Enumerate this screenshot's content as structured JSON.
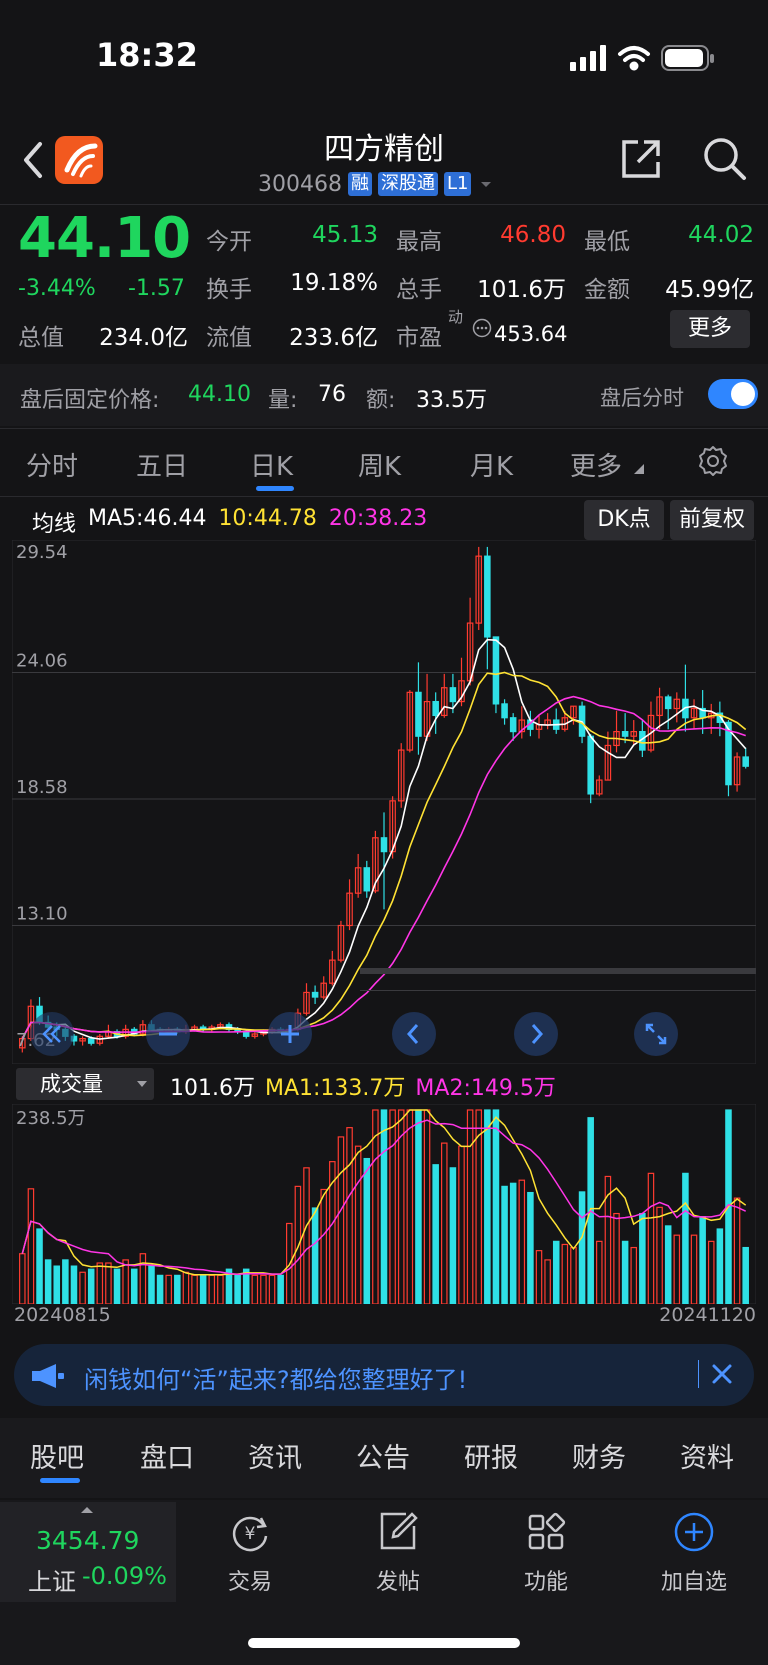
{
  "status": {
    "time": "18:32"
  },
  "header": {
    "title": "四方精创",
    "code": "300468",
    "tags": [
      "融",
      "深股通",
      "L1"
    ]
  },
  "quote": {
    "price": "44.10",
    "change_pct": "-3.44%",
    "change_amt": "-1.57",
    "open_label": "今开",
    "open": "45.13",
    "high_label": "最高",
    "high": "46.80",
    "low_label": "最低",
    "low": "44.02",
    "turnover_label": "换手",
    "turnover": "19.18%",
    "volume_label": "总手",
    "volume": "101.6万",
    "amount_label": "金额",
    "amount": "45.99亿",
    "mktcap_label": "总值",
    "mktcap": "234.0亿",
    "float_label": "流值",
    "float": "233.6亿",
    "pe_label": "市盈",
    "pe_sup": "动",
    "pe": "453.64",
    "more_label": "更多"
  },
  "after_hours": {
    "label": "盘后固定价格:",
    "price": "44.10",
    "vol_label": "量:",
    "vol": "76",
    "amt_label": "额:",
    "amt": "33.5万",
    "toggle_label": "盘后分时",
    "toggle_on": true
  },
  "period_tabs": [
    "分时",
    "五日",
    "日K",
    "周K",
    "月K",
    "更多"
  ],
  "active_period": "日K",
  "ma": {
    "label": "均线",
    "ma5": "MA5:46.44",
    "ma10": "10:44.78",
    "ma20": "20:38.23",
    "dk_btn": "DK点",
    "adj_btn": "前复权"
  },
  "volume_panel": {
    "selector": "成交量",
    "vol": "101.6万",
    "ma1": "MA1:133.7万",
    "ma2": "MA2:149.5万",
    "max_label": "238.5万"
  },
  "dates": {
    "start": "20240815",
    "end": "20241120"
  },
  "banner": {
    "text": "闲钱如何“活”起来?都给您整理好了!"
  },
  "section_tabs": [
    "股吧",
    "盘口",
    "资讯",
    "公告",
    "研报",
    "财务",
    "资料"
  ],
  "active_section": "股吧",
  "bottom_bar": {
    "index_value": "3454.79",
    "index_name": "上证",
    "index_change": "-0.09%",
    "items": [
      "交易",
      "发帖",
      "功能",
      "加自选"
    ]
  },
  "colors": {
    "up": "#ff3b30",
    "down": "#1fd65e",
    "candle_down": "#2fe0e6",
    "ma5": "#ffffff",
    "ma10": "#ffe234",
    "ma20": "#ff35e6",
    "accent": "#2f86ff"
  },
  "chart_data": {
    "type": "candlestick",
    "y_ticks": [
      "29.54",
      "24.06",
      "18.58",
      "13.10",
      "7.62"
    ],
    "ylim": [
      7.62,
      29.54
    ],
    "candles": [
      [
        7.8,
        8.2,
        7.6,
        8.3
      ],
      [
        8.2,
        9.6,
        8.1,
        9.9
      ],
      [
        9.6,
        8.9,
        8.8,
        10.0
      ],
      [
        8.9,
        8.7,
        8.5,
        9.2
      ],
      [
        8.7,
        8.6,
        8.3,
        8.9
      ],
      [
        8.6,
        8.3,
        8.1,
        8.7
      ],
      [
        8.3,
        8.1,
        7.9,
        8.4
      ],
      [
        8.1,
        8.2,
        7.9,
        8.3
      ],
      [
        8.2,
        8.0,
        7.9,
        8.3
      ],
      [
        8.0,
        8.3,
        7.9,
        8.4
      ],
      [
        8.3,
        8.5,
        8.2,
        8.8
      ],
      [
        8.5,
        8.3,
        8.2,
        8.6
      ],
      [
        8.3,
        8.6,
        8.2,
        8.8
      ],
      [
        8.6,
        8.4,
        8.3,
        8.7
      ],
      [
        8.4,
        8.8,
        8.3,
        9.0
      ],
      [
        8.8,
        8.6,
        8.5,
        9.0
      ],
      [
        8.6,
        8.5,
        8.4,
        8.7
      ],
      [
        8.5,
        8.6,
        8.4,
        8.7
      ],
      [
        8.6,
        8.5,
        8.4,
        8.7
      ],
      [
        8.5,
        8.6,
        8.4,
        8.8
      ],
      [
        8.6,
        8.7,
        8.5,
        8.8
      ],
      [
        8.7,
        8.6,
        8.5,
        8.8
      ],
      [
        8.6,
        8.7,
        8.5,
        8.8
      ],
      [
        8.7,
        8.8,
        8.6,
        8.9
      ],
      [
        8.8,
        8.6,
        8.5,
        8.9
      ],
      [
        8.6,
        8.5,
        8.4,
        8.7
      ],
      [
        8.5,
        8.3,
        8.2,
        8.6
      ],
      [
        8.3,
        8.4,
        8.2,
        8.5
      ],
      [
        8.4,
        8.5,
        8.3,
        8.6
      ],
      [
        8.5,
        8.6,
        8.4,
        8.7
      ],
      [
        8.6,
        8.5,
        8.4,
        8.7
      ],
      [
        8.5,
        8.6,
        8.4,
        8.8
      ],
      [
        8.6,
        9.3,
        8.5,
        9.5
      ],
      [
        9.3,
        10.2,
        9.2,
        10.6
      ],
      [
        10.2,
        10.0,
        9.7,
        10.5
      ],
      [
        10.0,
        10.6,
        9.9,
        10.9
      ],
      [
        10.6,
        11.6,
        10.5,
        12.0
      ],
      [
        11.6,
        13.1,
        11.5,
        13.3
      ],
      [
        13.1,
        14.5,
        12.9,
        15.1
      ],
      [
        14.5,
        15.6,
        14.3,
        16.2
      ],
      [
        15.6,
        14.6,
        14.3,
        15.9
      ],
      [
        14.6,
        16.9,
        14.5,
        17.2
      ],
      [
        16.9,
        16.3,
        13.8,
        18.0
      ],
      [
        16.3,
        18.5,
        16.0,
        18.7
      ],
      [
        18.5,
        20.7,
        18.2,
        21.0
      ],
      [
        20.7,
        23.2,
        20.6,
        23.3
      ],
      [
        23.2,
        21.3,
        20.5,
        24.5
      ],
      [
        21.3,
        22.8,
        21.1,
        24.0
      ],
      [
        22.8,
        22.2,
        21.4,
        23.2
      ],
      [
        22.2,
        23.4,
        22.1,
        24.0
      ],
      [
        23.4,
        22.8,
        22.3,
        24.0
      ],
      [
        22.8,
        23.7,
        22.6,
        24.7
      ],
      [
        23.7,
        26.2,
        23.5,
        27.3
      ],
      [
        26.2,
        29.1,
        25.9,
        29.5
      ],
      [
        29.1,
        25.6,
        24.2,
        29.5
      ],
      [
        25.6,
        22.7,
        22.3,
        24.6
      ],
      [
        22.7,
        22.1,
        21.8,
        22.9
      ],
      [
        22.1,
        21.5,
        21.1,
        22.3
      ],
      [
        21.5,
        22.0,
        21.2,
        22.6
      ],
      [
        22.0,
        21.6,
        21.3,
        22.4
      ],
      [
        21.6,
        21.8,
        21.2,
        22.2
      ],
      [
        21.8,
        22.0,
        21.6,
        22.3
      ],
      [
        22.0,
        21.6,
        21.4,
        22.5
      ],
      [
        21.6,
        22.1,
        21.5,
        22.4
      ],
      [
        22.1,
        22.6,
        21.8,
        22.6
      ],
      [
        22.6,
        21.3,
        21.0,
        22.8
      ],
      [
        21.3,
        18.8,
        18.4,
        21.4
      ],
      [
        18.8,
        19.4,
        18.7,
        19.6
      ],
      [
        19.4,
        20.9,
        19.4,
        21.5
      ],
      [
        20.9,
        21.5,
        20.6,
        22.4
      ],
      [
        21.5,
        21.3,
        21.0,
        22.3
      ],
      [
        21.3,
        21.5,
        20.9,
        22.0
      ],
      [
        21.5,
        20.7,
        20.4,
        22.0
      ],
      [
        20.7,
        22.2,
        20.6,
        22.8
      ],
      [
        22.2,
        23.0,
        21.6,
        23.4
      ],
      [
        23.0,
        22.5,
        21.6,
        23.1
      ],
      [
        22.5,
        22.9,
        21.9,
        23.2
      ],
      [
        22.9,
        22.1,
        21.5,
        24.4
      ],
      [
        22.1,
        22.5,
        21.6,
        22.9
      ],
      [
        22.5,
        22.1,
        21.4,
        23.3
      ],
      [
        22.1,
        22.3,
        21.4,
        22.7
      ],
      [
        22.3,
        21.9,
        21.3,
        22.8
      ],
      [
        21.9,
        19.2,
        18.7,
        22.0
      ],
      [
        19.2,
        20.4,
        18.9,
        20.6
      ],
      [
        20.4,
        20.0,
        19.9,
        20.8
      ]
    ],
    "volume_ylim": [
      0,
      238.5
    ]
  }
}
